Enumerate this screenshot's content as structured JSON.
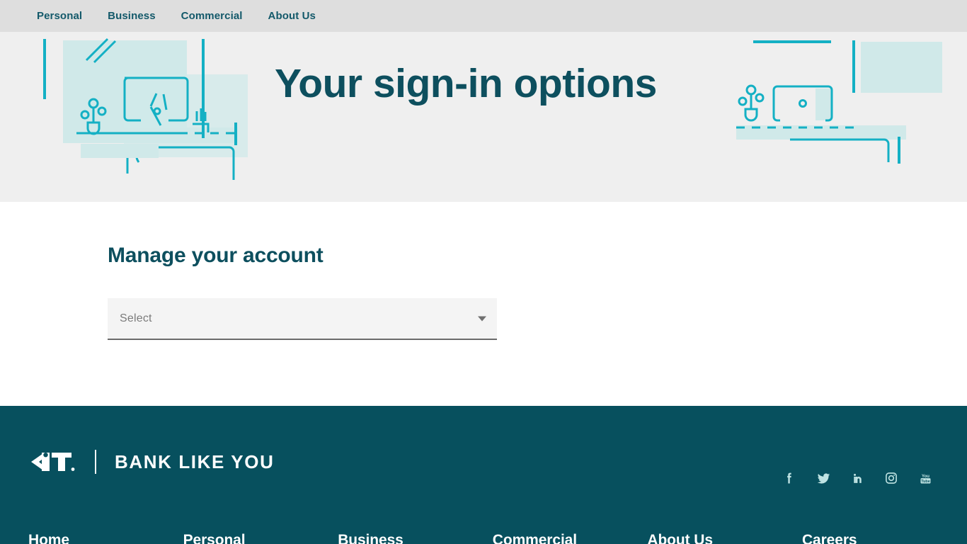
{
  "topnav": {
    "items": [
      {
        "label": "Personal"
      },
      {
        "label": "Business"
      },
      {
        "label": "Commercial"
      },
      {
        "label": "About Us"
      }
    ]
  },
  "hero": {
    "title": "Your sign-in options"
  },
  "main": {
    "heading": "Manage your account",
    "select": {
      "value": "Select",
      "placeholder": "Select",
      "caret_icon": "chevron-down-icon"
    }
  },
  "footer": {
    "logo_text": "CIT",
    "tagline": "BANK LIKE YOU",
    "socials": [
      {
        "name": "facebook-icon",
        "label": "Facebook"
      },
      {
        "name": "twitter-icon",
        "label": "Twitter"
      },
      {
        "name": "linkedin-icon",
        "label": "LinkedIn"
      },
      {
        "name": "instagram-icon",
        "label": "Instagram"
      },
      {
        "name": "youtube-icon",
        "label": "YouTube"
      }
    ],
    "columns": [
      {
        "title": "Home"
      },
      {
        "title": "Personal"
      },
      {
        "title": "Business"
      },
      {
        "title": "Commercial"
      },
      {
        "title": "About Us"
      },
      {
        "title": "Careers"
      }
    ]
  },
  "colors": {
    "nav_bg": "#dedede",
    "hero_bg": "#efefef",
    "brand_teal": "#0d4f5e",
    "footer_bg": "#07505e",
    "accent_teal": "#14b0c4",
    "accent_fill": "#d0e9e9",
    "social_icon": "#bfe3e3"
  }
}
